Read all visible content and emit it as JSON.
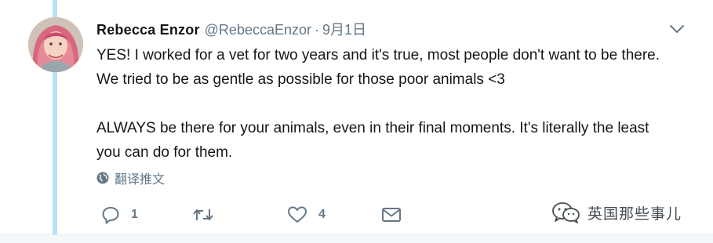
{
  "tweet": {
    "author_name": "Rebecca Enzor",
    "author_handle": "@RebeccaEnzor",
    "separator": "·",
    "date": "9月1日",
    "paragraphs": [
      "YES! I worked for a vet for two years and it's true, most people don't want to be there. We tried to be as gentle as possible for those poor animals <3",
      "ALWAYS be there for your animals, even in their final moments. It's literally the least you can do for them."
    ],
    "translate_label": "翻译推文"
  },
  "actions": {
    "reply_count": "1",
    "retweet_count": "",
    "like_count": "4"
  },
  "watermark": {
    "text": "英国那些事儿"
  },
  "icons": {
    "avatar": "avatar-photo",
    "caret": "chevron-down-icon",
    "translate": "globe-icon",
    "reply": "reply-icon",
    "retweet": "retweet-icon",
    "like": "heart-icon",
    "dm": "envelope-icon",
    "watermark": "wechat-icon"
  },
  "colors": {
    "text": "#14171a",
    "secondary": "#657786",
    "thread_line": "#b7e1f7"
  }
}
